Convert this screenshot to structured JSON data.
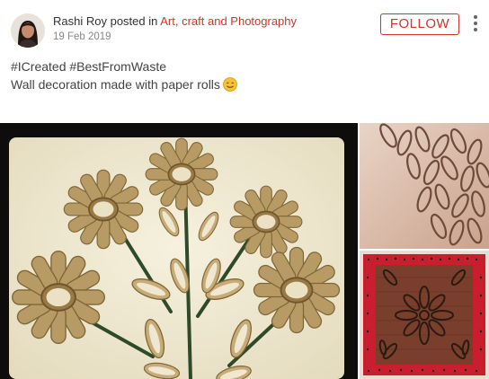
{
  "post": {
    "author": "Rashi Roy",
    "posted_in": "posted in",
    "community": "Art, craft and Photography",
    "date": "19 Feb 2019",
    "follow_label": "FOLLOW",
    "hashtags": "#ICreated #BestFromWaste",
    "caption": "Wall decoration made with paper rolls"
  },
  "icons": {
    "avatar": "avatar",
    "more": "more-vertical-icon",
    "emoji": "smiling-face-emoji"
  },
  "colors": {
    "accent": "#d0342c",
    "text": "#333333",
    "muted": "#888888"
  }
}
